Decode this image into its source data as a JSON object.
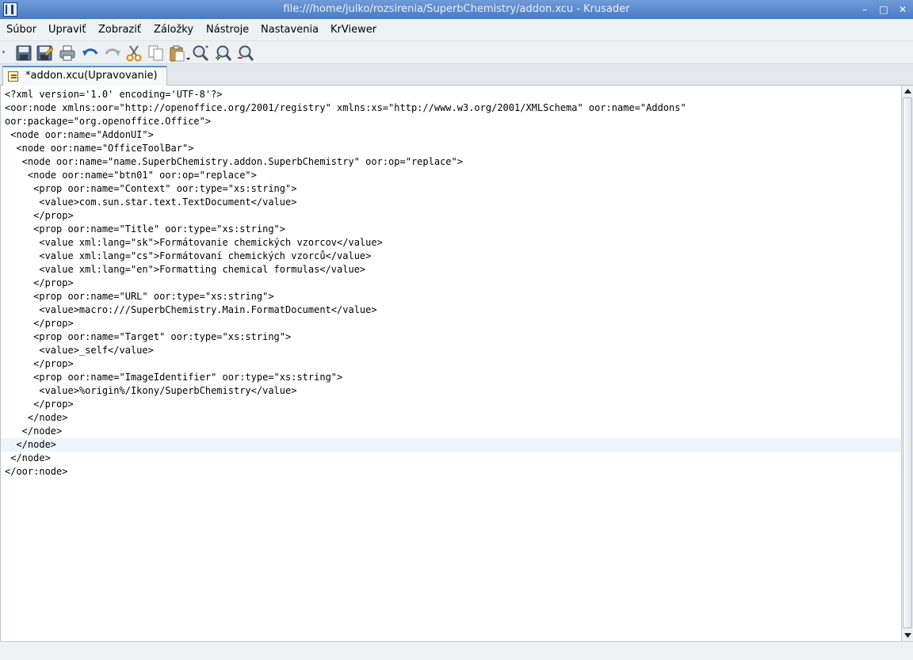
{
  "window": {
    "title": "file:///home/julko/rozsirenia/SuperbChemistry/addon.xcu - Krusader",
    "app_icon": "krusader-app-icon",
    "controls": [
      {
        "icon": "minimize-icon",
        "glyph": "–"
      },
      {
        "icon": "maximize-icon",
        "glyph": "□"
      },
      {
        "icon": "close-icon",
        "glyph": "✕"
      }
    ]
  },
  "menu": {
    "items": [
      {
        "label": "Súbor"
      },
      {
        "label": "Upraviť"
      },
      {
        "label": "Zobraziť"
      },
      {
        "label": "Záložky"
      },
      {
        "label": "Nástroje"
      },
      {
        "label": "Nastavenia"
      },
      {
        "label": "KrViewer"
      }
    ]
  },
  "toolbar": {
    "buttons": [
      {
        "icon": "save-icon",
        "enabled": true
      },
      {
        "icon": "save-as-icon",
        "enabled": true
      },
      {
        "icon": "print-icon",
        "enabled": true
      },
      {
        "icon": "undo-icon",
        "enabled": true
      },
      {
        "icon": "redo-icon",
        "enabled": false
      },
      {
        "icon": "cut-icon",
        "enabled": true
      },
      {
        "icon": "copy-icon",
        "enabled": true
      },
      {
        "icon": "paste-icon",
        "enabled": true
      },
      {
        "icon": "find-icon",
        "enabled": true
      },
      {
        "icon": "zoom-in-icon",
        "enabled": true
      },
      {
        "icon": "zoom-out-icon",
        "enabled": true
      }
    ]
  },
  "tabs": [
    {
      "label": "*addon.xcu(Upravovanie)",
      "icon": "edit-document-icon",
      "active": true
    }
  ],
  "editor": {
    "current_line": 26,
    "lines": [
      "<?xml version='1.0' encoding='UTF-8'?>",
      "<oor:node xmlns:oor=\"http://openoffice.org/2001/registry\" xmlns:xs=\"http://www.w3.org/2001/XMLSchema\" oor:name=\"Addons\"",
      "oor:package=\"org.openoffice.Office\">",
      " <node oor:name=\"AddonUI\">",
      "  <node oor:name=\"OfficeToolBar\">",
      "   <node oor:name=\"name.SuperbChemistry.addon.SuperbChemistry\" oor:op=\"replace\">",
      "    <node oor:name=\"btn01\" oor:op=\"replace\">",
      "     <prop oor:name=\"Context\" oor:type=\"xs:string\">",
      "      <value>com.sun.star.text.TextDocument</value>",
      "     </prop>",
      "     <prop oor:name=\"Title\" oor:type=\"xs:string\">",
      "      <value xml:lang=\"sk\">Formátovanie chemických vzorcov</value>",
      "      <value xml:lang=\"cs\">Formátovaní chemických vzorců</value>",
      "      <value xml:lang=\"en\">Formatting chemical formulas</value>",
      "     </prop>",
      "     <prop oor:name=\"URL\" oor:type=\"xs:string\">",
      "      <value>macro:///SuperbChemistry.Main.FormatDocument</value>",
      "     </prop>",
      "     <prop oor:name=\"Target\" oor:type=\"xs:string\">",
      "      <value>_self</value>",
      "     </prop>",
      "     <prop oor:name=\"ImageIdentifier\" oor:type=\"xs:string\">",
      "      <value>%origin%/Ikony/SuperbChemistry</value>",
      "     </prop>",
      "    </node>",
      "   </node>",
      "  </node>",
      " </node>",
      "</oor:node>"
    ]
  },
  "scrollbar": {
    "up_icon": "scroll-up-arrow-icon",
    "down_icon": "scroll-down-arrow-icon"
  }
}
